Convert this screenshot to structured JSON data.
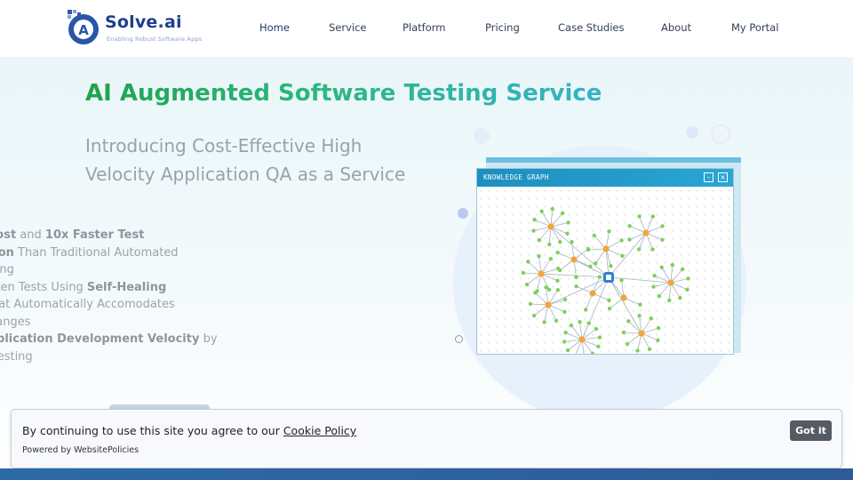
{
  "brand": {
    "name": "Solve.ai",
    "tagline": "Enabling Robust Software Apps",
    "icon": "solve-ai-logo"
  },
  "nav": {
    "items": [
      {
        "label": "Home",
        "active": true
      },
      {
        "label": "Service"
      },
      {
        "label": "Platform"
      },
      {
        "label": "Pricing"
      },
      {
        "label": "Case Studies"
      },
      {
        "label": "About"
      },
      {
        "label": "My Portal"
      }
    ]
  },
  "hero": {
    "title": "AI Augmented Software Testing Service",
    "subtitle_line1": "Introducing Cost-Effective High",
    "subtitle_line2": "Velocity Application QA as a Service",
    "features": [
      {
        "bold1": "wer Cost",
        "text1": " and ",
        "bold2": "10x Faster Test",
        "text2": ""
      },
      {
        "bold1": "entation",
        "text1": " Than Traditional Automated",
        "bold2": "",
        "text2": ""
      },
      {
        "bold1": "",
        "text1": "e Testing",
        "bold2": "",
        "text2": ""
      },
      {
        "bold1": "",
        "text1": "er Broken Tests Using ",
        "bold2": "Self-Healing",
        "text2": ""
      },
      {
        "bold1": "",
        "text1": "ogy That Automatically Accomodates",
        "bold2": "",
        "text2": ""
      },
      {
        "bold1": "",
        "text1": "ion Changes",
        "bold2": "",
        "text2": ""
      },
      {
        "bold1": "ed Application Development Velocity",
        "text1": " by",
        "bold2": "",
        "text2": ""
      },
      {
        "bold1": "",
        "text1": " Early Testing",
        "bold2": "",
        "text2": ""
      }
    ]
  },
  "illustration": {
    "window_title": "KNOWLEDGE GRAPH",
    "minimize_icon": "minimize-icon",
    "close_icon": "close-icon",
    "colors": {
      "hub": "#2f7fd6",
      "cluster": "#f3a53a",
      "leaf": "#7fcf5a",
      "edge": "#a6b4bf"
    }
  },
  "cookie": {
    "message": "By continuing to use this site you agree to our ",
    "link_label": "Cookie Policy",
    "powered_by": "Powered by WebsitePolicies",
    "button_label": "Got it"
  }
}
